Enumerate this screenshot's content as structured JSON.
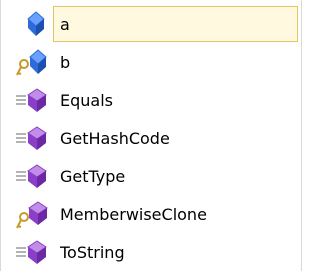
{
  "items": [
    {
      "label": "a",
      "icon": "field-icon",
      "selected": true
    },
    {
      "label": "b",
      "icon": "property-icon",
      "selected": false
    },
    {
      "label": "Equals",
      "icon": "method-icon",
      "selected": false
    },
    {
      "label": "GetHashCode",
      "icon": "method-icon",
      "selected": false
    },
    {
      "label": "GetType",
      "icon": "method-icon",
      "selected": false
    },
    {
      "label": "MemberwiseClone",
      "icon": "protected-method-icon",
      "selected": false
    },
    {
      "label": "ToString",
      "icon": "method-icon",
      "selected": false
    }
  ],
  "colors": {
    "selection_fill": "#fff9e0",
    "selection_border": "#e5c365",
    "field_blue": "#2f6bd8",
    "method_purple": "#8a3fc8",
    "key_gold": "#c89a2a"
  }
}
